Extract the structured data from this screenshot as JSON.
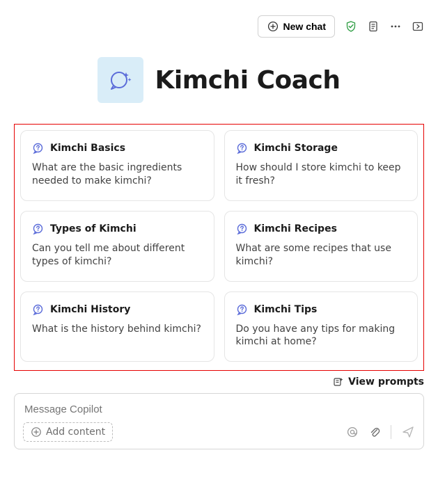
{
  "toolbar": {
    "new_chat_label": "New chat"
  },
  "hero": {
    "title": "Kimchi Coach"
  },
  "prompt_cards": [
    {
      "title": "Kimchi Basics",
      "body": "What are the basic ingredients needed to make kimchi?"
    },
    {
      "title": "Kimchi Storage",
      "body": "How should I store kimchi to keep it fresh?"
    },
    {
      "title": "Types of Kimchi",
      "body": "Can you tell me about different types of kimchi?"
    },
    {
      "title": "Kimchi Recipes",
      "body": "What are some recipes that use kimchi?"
    },
    {
      "title": "Kimchi History",
      "body": "What is the history behind kimchi?"
    },
    {
      "title": "Kimchi Tips",
      "body": "Do you have any tips for making kimchi at home?"
    }
  ],
  "links": {
    "view_prompts": "View prompts"
  },
  "composer": {
    "placeholder": "Message Copilot",
    "add_content_label": "Add content"
  }
}
